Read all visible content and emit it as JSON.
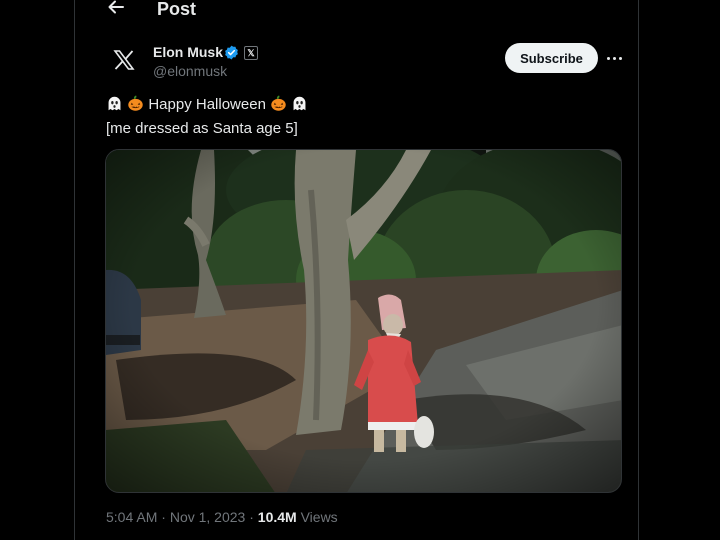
{
  "header": {
    "back_icon": "arrow-left-icon",
    "title": "Post"
  },
  "author": {
    "avatar_icon": "x-logo-icon",
    "name": "Elon Musk",
    "verified_icon": "verified-badge-icon",
    "affiliate_icon": "x-affiliate-badge-icon",
    "affiliate_glyph": "𝕏",
    "handle": "@elonmusk"
  },
  "subscribe_label": "Subscribe",
  "more_icon": "more-options-icon",
  "post": {
    "line1_text": "Happy Halloween",
    "line2_text": "[me dressed as Santa age 5]",
    "emojis": [
      "ghost-icon",
      "jack-o-lantern-icon"
    ],
    "media": {
      "kind": "photo"
    }
  },
  "meta": {
    "time": "5:04 AM",
    "sep1": " · ",
    "date": "Nov 1, 2023",
    "sep2": " · ",
    "views_count": "10.4M",
    "views_label": " Views"
  },
  "colors": {
    "background": "#000000",
    "text": "#e7e9ea",
    "secondary_text": "#71767b",
    "verified": "#1d9bf0",
    "border": "#2f3336",
    "subscribe_bg": "#eff3f4"
  }
}
